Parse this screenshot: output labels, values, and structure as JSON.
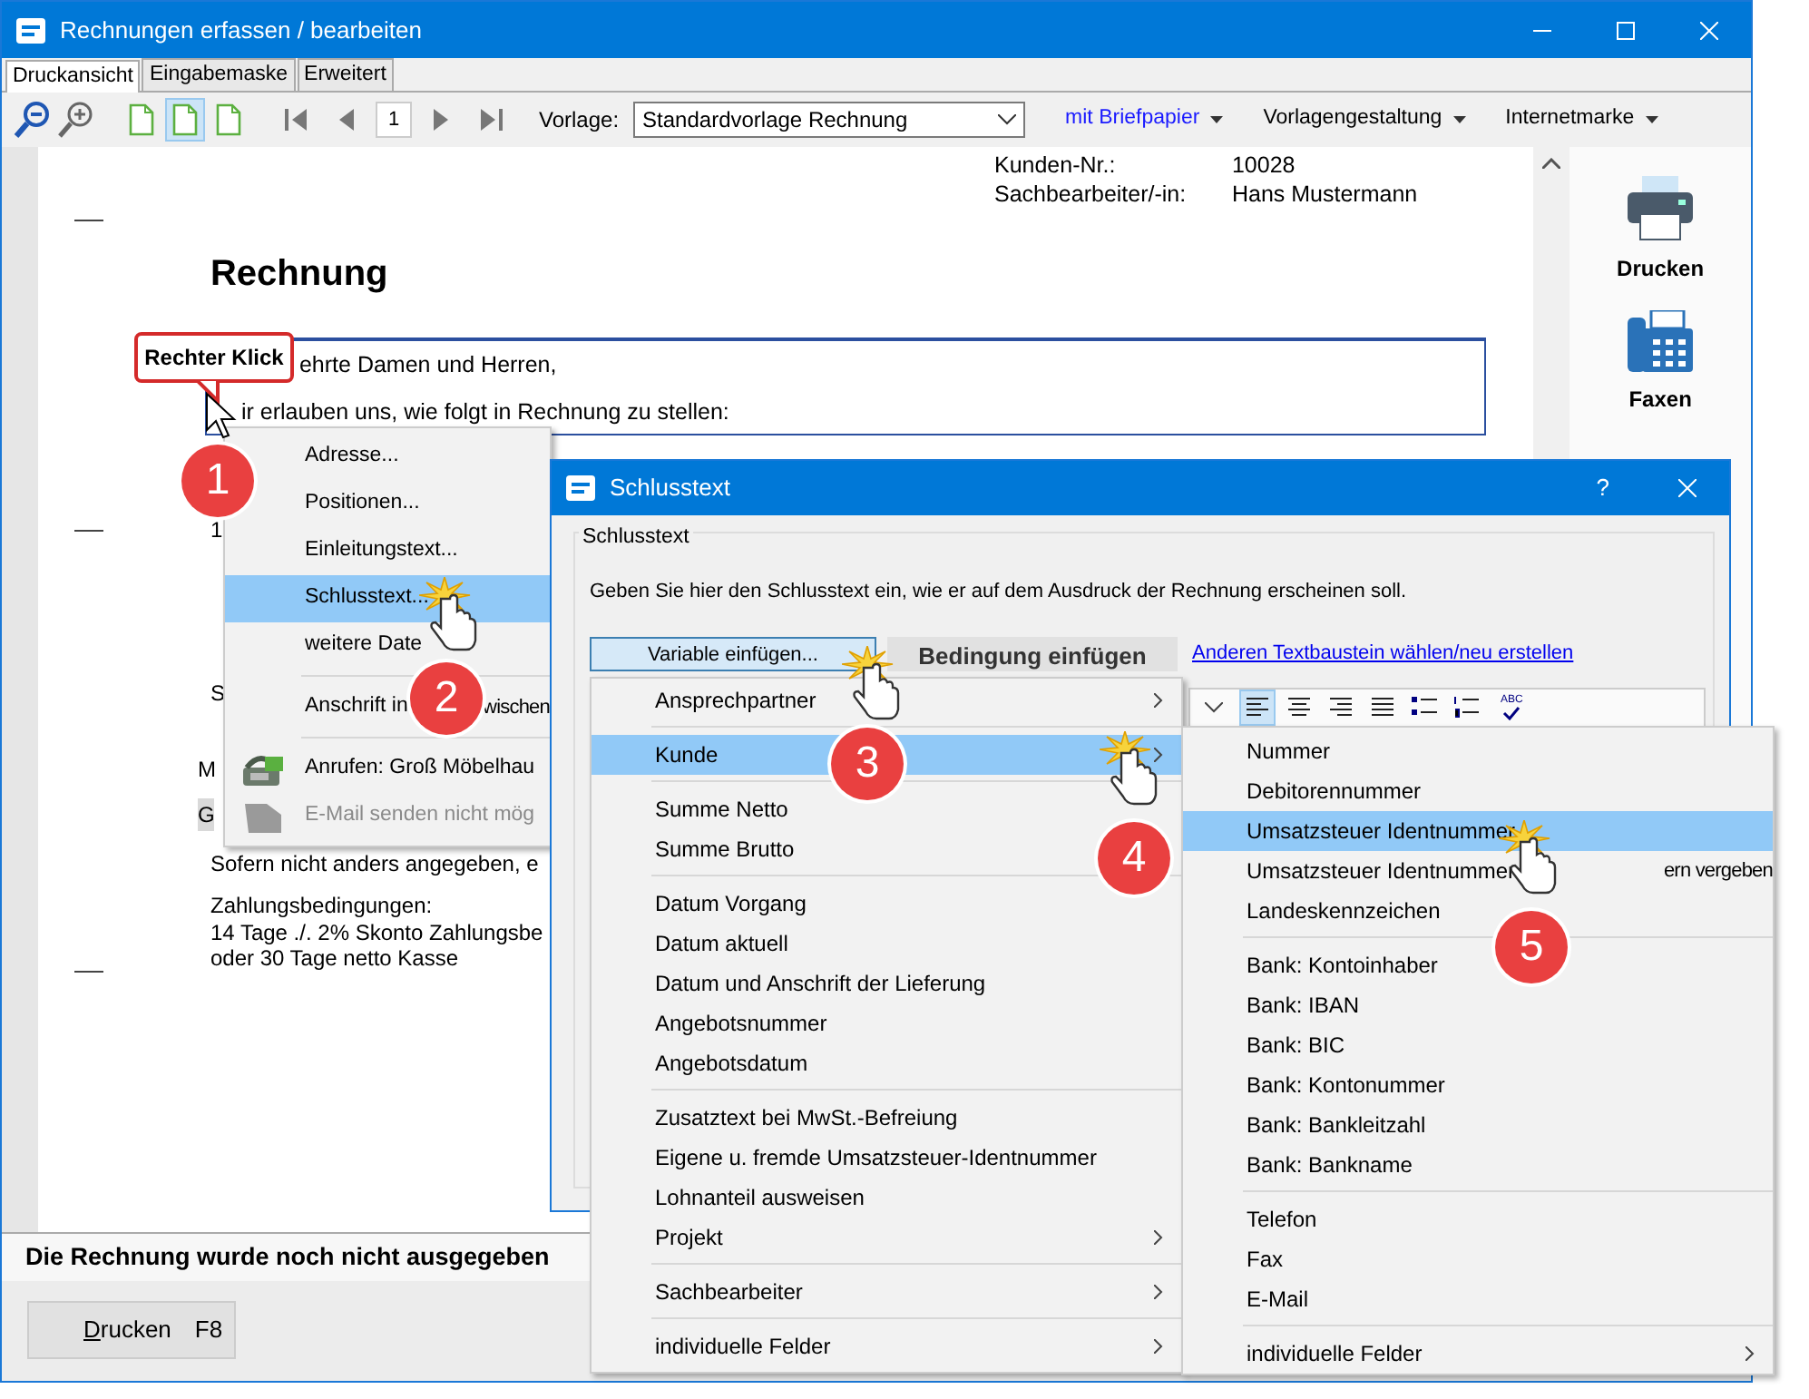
{
  "window": {
    "title": "Rechnungen erfassen / bearbeiten"
  },
  "tabs": [
    {
      "label": "Druckansicht",
      "selected": true
    },
    {
      "label": "Eingabemaske",
      "selected": false
    },
    {
      "label": "Erweitert",
      "selected": false
    }
  ],
  "toolbar": {
    "view_modes": [
      {
        "selected": false
      },
      {
        "selected": true
      },
      {
        "selected": false
      }
    ],
    "page": "1",
    "template_label": "Vorlage:",
    "template": "Standardvorlage Rechnung",
    "menus": [
      {
        "label": "mit Briefpapier",
        "kind": "link"
      },
      {
        "label": "Vorlagengestaltung",
        "kind": "plain"
      },
      {
        "label": "Internetmarke",
        "kind": "plain"
      }
    ]
  },
  "document": {
    "header": [
      {
        "label": "Kunden-Nr.:",
        "value": "10028"
      },
      {
        "label": "Sachbearbeiter/-in:",
        "value": "Hans Mustermann"
      }
    ],
    "title": "Rechnung",
    "intro_lines": [
      "ehrte Damen und Herren,",
      "ir erlauben uns, wie folgt in Rechnung zu stellen:"
    ],
    "fragments": [
      {
        "text": "1",
        "highlighted": false
      },
      {
        "text": "S",
        "highlighted": false
      },
      {
        "text": "M",
        "highlighted": false
      },
      {
        "text": "G",
        "highlighted": true
      },
      {
        "text": "Sofern nicht anders angegeben, e",
        "highlighted": false
      }
    ],
    "terms": [
      "Zahlungsbedingungen:",
      "14 Tage ./. 2% Skonto Zahlungsbe",
      "oder 30 Tage netto Kasse"
    ]
  },
  "side_actions": [
    {
      "label": "Drucken",
      "kind": "printer"
    },
    {
      "label": "Faxen",
      "kind": "fax"
    }
  ],
  "status": "Die Rechnung wurde noch nicht ausgegeben",
  "bottom_button": {
    "label": "Drucken",
    "shortcut": "F8"
  },
  "callout": "Rechter Klick",
  "context_menu": [
    {
      "kind": "item",
      "text": "Adresse...",
      "selected": false,
      "disabled": false
    },
    {
      "kind": "item",
      "text": "Positionen...",
      "selected": false,
      "disabled": false
    },
    {
      "kind": "item",
      "text": "Einleitungstext...",
      "selected": false,
      "disabled": false
    },
    {
      "kind": "item",
      "text": "Schlusstext...",
      "selected": true,
      "disabled": false
    },
    {
      "kind": "item",
      "text": "weitere Date",
      "selected": false,
      "disabled": false
    },
    {
      "kind": "separator"
    },
    {
      "kind": "item",
      "text": "Anschrift in",
      "tail": "wischen",
      "selected": false,
      "disabled": false
    },
    {
      "kind": "separator"
    },
    {
      "kind": "phone",
      "text": "Anrufen: Groß Möbelhau",
      "selected": false,
      "disabled": false
    },
    {
      "kind": "mail",
      "text": "E-Mail senden nicht mög",
      "selected": false,
      "disabled": true
    }
  ],
  "dialog": {
    "title": "Schlusstext",
    "help": "?",
    "group": "Schlusstext",
    "description": "Geben Sie hier den Schlusstext ein, wie er auf dem Ausdruck der Rechnung erscheinen soll.",
    "buttons": [
      {
        "label": "Variable einfügen...",
        "pressed": true
      },
      {
        "label": "Bedingung einfügen",
        "pressed": false
      }
    ],
    "link": "Anderen Textbaustein wählen/neu erstellen",
    "format_buttons": [
      {
        "kind": "align-left",
        "selected": true
      },
      {
        "kind": "align-center",
        "selected": false
      },
      {
        "kind": "align-right",
        "selected": false
      },
      {
        "kind": "justify",
        "selected": false
      },
      {
        "kind": "bullets",
        "selected": false
      },
      {
        "kind": "numbering",
        "selected": false
      }
    ],
    "spellcheck": "ABC"
  },
  "variable_menu": [
    {
      "kind": "item",
      "text": "Ansprechpartner",
      "submenu": true,
      "selected": false
    },
    {
      "kind": "separator"
    },
    {
      "kind": "item",
      "text": "Kunde",
      "submenu": true,
      "selected": true
    },
    {
      "kind": "separator"
    },
    {
      "kind": "item",
      "text": "Summe Netto",
      "submenu": false,
      "selected": false
    },
    {
      "kind": "item",
      "text": "Summe Brutto",
      "submenu": false,
      "selected": false
    },
    {
      "kind": "separator"
    },
    {
      "kind": "item",
      "text": "Datum Vorgang",
      "submenu": false,
      "selected": false
    },
    {
      "kind": "item",
      "text": "Datum aktuell",
      "submenu": false,
      "selected": false
    },
    {
      "kind": "item",
      "text": "Datum und Anschrift der Lieferung",
      "submenu": false,
      "selected": false
    },
    {
      "kind": "item",
      "text": "Angebotsnummer",
      "submenu": false,
      "selected": false
    },
    {
      "kind": "item",
      "text": "Angebotsdatum",
      "submenu": false,
      "selected": false
    },
    {
      "kind": "separator"
    },
    {
      "kind": "item",
      "text": "Zusatztext bei MwSt.-Befreiung",
      "submenu": false,
      "selected": false
    },
    {
      "kind": "item",
      "text": "Eigene u. fremde Umsatzsteuer-Identnummer",
      "submenu": false,
      "selected": false
    },
    {
      "kind": "item",
      "text": "Lohnanteil ausweisen",
      "submenu": false,
      "selected": false
    },
    {
      "kind": "item",
      "text": "Projekt",
      "submenu": true,
      "selected": false
    },
    {
      "kind": "separator"
    },
    {
      "kind": "item",
      "text": "Sachbearbeiter",
      "submenu": true,
      "selected": false
    },
    {
      "kind": "separator"
    },
    {
      "kind": "item",
      "text": "individuelle Felder",
      "submenu": true,
      "selected": false
    }
  ],
  "customer_menu": [
    {
      "kind": "item",
      "text": "Nummer",
      "submenu": false,
      "selected": false
    },
    {
      "kind": "item",
      "text": "Debitorennummer",
      "submenu": false,
      "selected": false
    },
    {
      "kind": "item",
      "text": "Umsatzsteuer Identnummer",
      "submenu": false,
      "selected": true
    },
    {
      "kind": "item",
      "text": "Umsatzsteuer Identnummer",
      "tail": "ern vergeben",
      "submenu": false,
      "selected": false
    },
    {
      "kind": "item",
      "text": "Landeskennzeichen",
      "submenu": false,
      "selected": false
    },
    {
      "kind": "separator"
    },
    {
      "kind": "item",
      "text": "Bank: Kontoinhaber",
      "submenu": false,
      "selected": false
    },
    {
      "kind": "item",
      "text": "Bank: IBAN",
      "submenu": false,
      "selected": false
    },
    {
      "kind": "item",
      "text": "Bank: BIC",
      "submenu": false,
      "selected": false
    },
    {
      "kind": "item",
      "text": "Bank: Kontonummer",
      "submenu": false,
      "selected": false
    },
    {
      "kind": "item",
      "text": "Bank: Bankleitzahl",
      "submenu": false,
      "selected": false
    },
    {
      "kind": "item",
      "text": "Bank: Bankname",
      "submenu": false,
      "selected": false
    },
    {
      "kind": "separator"
    },
    {
      "kind": "item",
      "text": "Telefon",
      "submenu": false,
      "selected": false
    },
    {
      "kind": "item",
      "text": "Fax",
      "submenu": false,
      "selected": false
    },
    {
      "kind": "item",
      "text": "E-Mail",
      "submenu": false,
      "selected": false
    },
    {
      "kind": "separator"
    },
    {
      "kind": "item",
      "text": "individuelle Felder",
      "submenu": true,
      "selected": false
    }
  ],
  "steps": [
    "1",
    "2",
    "3",
    "4",
    "5"
  ]
}
